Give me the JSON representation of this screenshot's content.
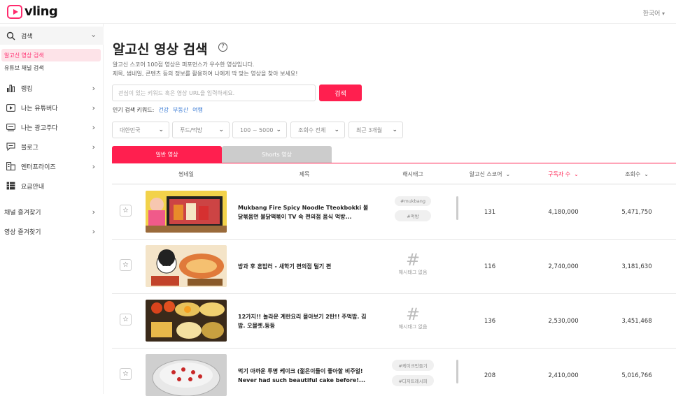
{
  "app": {
    "logo": "vling",
    "language": "한국어"
  },
  "sidebar": {
    "search": {
      "label": "검색"
    },
    "sub_items": [
      {
        "label": "알고신 영상 검색",
        "active": true
      },
      {
        "label": "유튜브 채널 검색",
        "active": false
      }
    ],
    "items": [
      {
        "label": "랭킹",
        "icon": "ranking-bars-icon"
      },
      {
        "label": "나는 유튜버다",
        "icon": "youtube-play-icon"
      },
      {
        "label": "나는 광고주다",
        "icon": "ad-icon"
      },
      {
        "label": "블로그",
        "icon": "blog-icon"
      },
      {
        "label": "엔터프라이즈",
        "icon": "enterprise-icon"
      },
      {
        "label": "요금안내",
        "icon": "pricing-icon"
      }
    ],
    "bottom_items": [
      {
        "label": "채널 즐겨찾기"
      },
      {
        "label": "영상 즐겨찾기"
      }
    ]
  },
  "main": {
    "title": "알고신 영상 검색",
    "description_1": "알고신 스코어 100점 영상은 퍼포먼스가 우수한 영상입니다.",
    "description_2": "제목, 썸네일, 콘텐츠 등의 정보를 활용하여 나에게 딱 맞는 영상을 찾아 보세요!",
    "search": {
      "placeholder": "관심이 있는 키워드 혹은 영상 URL을 입력하세요.",
      "button": "검색"
    },
    "popular": {
      "label": "인기 검색 키워드:",
      "keywords": [
        "건강",
        "부동산",
        "여행"
      ]
    },
    "filters": [
      "대한민국",
      "푸드/먹방",
      "100 ~ 5000",
      "조회수 전체",
      "최근 3개월"
    ],
    "tabs": [
      "일반 영상",
      "Shorts 영상"
    ],
    "columns": [
      "썸네일",
      "제목",
      "해시태그",
      "알고신 스코어",
      "구독자 수",
      "조회수"
    ],
    "active_sort_color": "#ff1f4f",
    "rows": [
      {
        "title": "Mukbang Fire Spicy Noodle Tteokbokki 불닭볶음면 불닭떡볶이 TV 속 편의점 음식 먹방...",
        "tags": [
          "#mukbang",
          "#먹방"
        ],
        "score": "131",
        "subscribers": "4,180,000",
        "views": "5,471,750"
      },
      {
        "title": "방과 후 혼밥러 - 새학기 편의점 털기 편",
        "tags": [],
        "score": "116",
        "subscribers": "2,740,000",
        "views": "3,181,630"
      },
      {
        "title": "12가지!! 놀라운 계란요리 몰아보기 2탄!! 주먹밥. 김밥. 오믈렛.등등",
        "tags": [],
        "score": "136",
        "subscribers": "2,530,000",
        "views": "3,451,468"
      },
      {
        "title": "먹기 아까운 투명 케이크 (젊은이들이 좋아할 비주얼! Never had such beautiful cake before!...",
        "tags": [
          "#케이크만들기",
          "#디저트레시피"
        ],
        "score": "208",
        "subscribers": "2,410,000",
        "views": "5,016,766"
      }
    ],
    "no_hashtag": "해시태그 없음",
    "hash_symbol": "#"
  }
}
